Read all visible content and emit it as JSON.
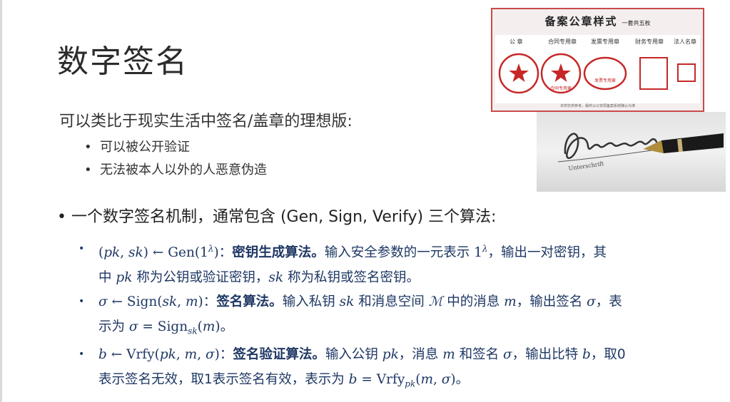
{
  "title": "数字签名",
  "intro": "可以类比于现实生活中签名/盖章的理想版:",
  "sub_points": [
    "可以被公开验证",
    "无法被本人以外的人恶意伪造"
  ],
  "bullet_symbol": "•",
  "main_point": "一个数字签名机制，通常包含 (Gen, Sign, Verify) 三个算法:",
  "items": [
    {
      "lead": "(pk, sk) ← Gen(1^λ)：",
      "name": "密钥生成算法。",
      "line1": "输入安全参数的一元表示 1^λ，输出一对密钥，其",
      "line2": "中 pk 称为公钥或验证密钥，sk 称为私钥或签名密钥。"
    },
    {
      "lead": "σ ← Sign(sk, m)：",
      "name": "签名算法。",
      "line1": "输入私钥 sk 和消息空间 ℳ 中的消息 m，输出签名 σ，表",
      "line2": "示为 σ = Sign_sk(m)。"
    },
    {
      "lead": "b ← Vrfy(pk, m, σ)：",
      "name": "签名验证算法。",
      "line1": "输入公钥 pk，消息 m 和签名 σ，输出比特 b，取0",
      "line2": "表示签名无效，取1表示签名有效，表示为 b = Vrfy_pk(m, σ)。"
    }
  ],
  "stamp_image": {
    "title": "备案公章样式",
    "subtitle": "一套共五枚",
    "labels": [
      "公 章",
      "合同专用章",
      "发票专用章",
      "财务专用章",
      "法人名章"
    ],
    "stamp_texts": [
      "合同专用章",
      "发票专用章"
    ],
    "footnote": "本样仅供参考，最终以公安局备案系统确认为准"
  },
  "signature_image": {
    "caption": "Unterschrift"
  },
  "colors": {
    "title": "#2b2b2b",
    "body_blue": "#1f3864",
    "stamp_red": "#c62828"
  }
}
